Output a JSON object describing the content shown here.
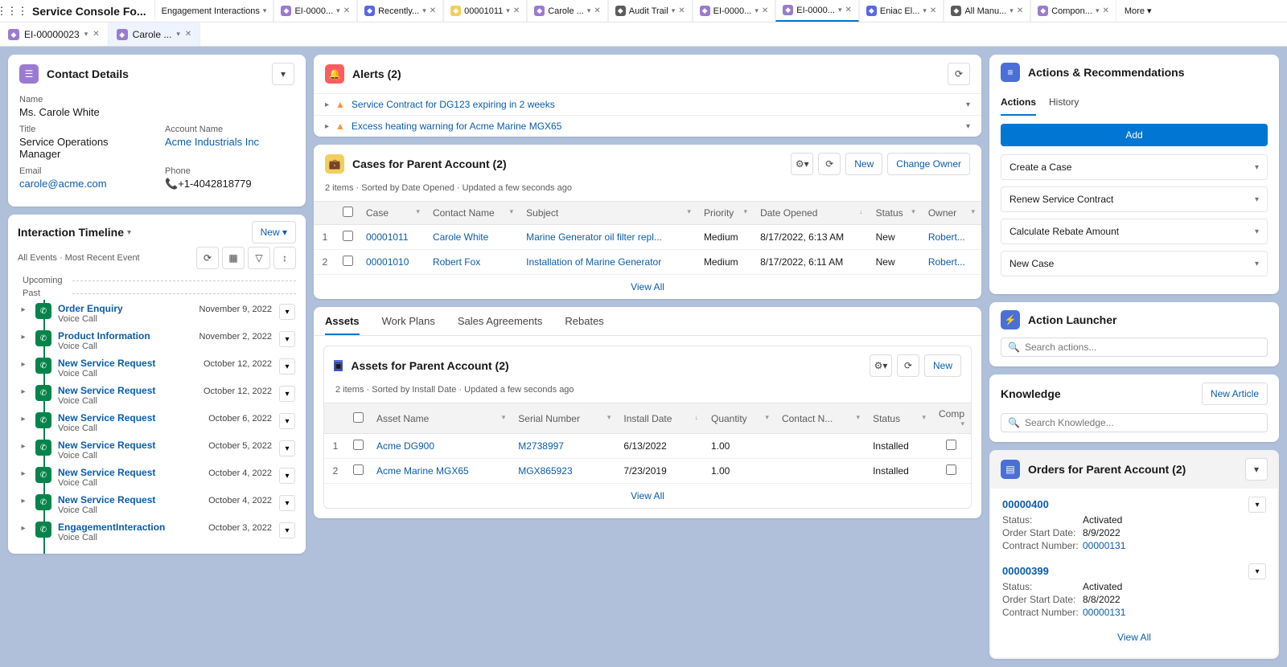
{
  "appName": "Service Console Fo...",
  "moreLabel": "More",
  "navTabs": [
    {
      "label": "Engagement Interactions",
      "closeable": false,
      "iconBg": ""
    },
    {
      "label": "EI-0000...",
      "closeable": true,
      "iconBg": "#9a7bcf"
    },
    {
      "label": "Recently...",
      "closeable": true,
      "iconBg": "#5867e8"
    },
    {
      "label": "00001011",
      "closeable": true,
      "iconBg": "#f2cf5b"
    },
    {
      "label": "Carole ...",
      "closeable": true,
      "iconBg": "#9a7bcf"
    },
    {
      "label": "Audit Trail",
      "closeable": true,
      "iconBg": "#5c5c5c"
    },
    {
      "label": "EI-0000...",
      "closeable": true,
      "iconBg": "#9a7bcf"
    },
    {
      "label": "EI-0000...",
      "closeable": true,
      "iconBg": "#9a7bcf",
      "active": true
    },
    {
      "label": "Eniac El...",
      "closeable": true,
      "iconBg": "#5867e8"
    },
    {
      "label": "All Manu...",
      "closeable": true,
      "iconBg": "#5c5c5c"
    },
    {
      "label": "Compon...",
      "closeable": true,
      "iconBg": "#9a7bcf"
    }
  ],
  "subTabs": [
    {
      "label": "EI-00000023",
      "active": false
    },
    {
      "label": "Carole ...",
      "active": true
    }
  ],
  "contactDetails": {
    "title": "Contact Details",
    "fields": {
      "nameLabel": "Name",
      "nameValue": "Ms. Carole White",
      "titleLabel": "Title",
      "titleValue": "Service Operations Manager",
      "accountLabel": "Account Name",
      "accountValue": "Acme Industrials Inc",
      "emailLabel": "Email",
      "emailValue": "carole@acme.com",
      "phoneLabel": "Phone",
      "phoneValue": "+1-4042818779"
    }
  },
  "timeline": {
    "title": "Interaction Timeline",
    "newLabel": "New",
    "subtitle": "All Events · Most Recent Event",
    "upcoming": "Upcoming",
    "past": "Past",
    "items": [
      {
        "title": "Order Enquiry",
        "sub": "Voice Call",
        "date": "November 9, 2022"
      },
      {
        "title": "Product Information",
        "sub": "Voice Call",
        "date": "November 2, 2022"
      },
      {
        "title": "New Service Request",
        "sub": "Voice Call",
        "date": "October 12, 2022"
      },
      {
        "title": "New Service Request",
        "sub": "Voice Call",
        "date": "October 12, 2022"
      },
      {
        "title": "New Service Request",
        "sub": "Voice Call",
        "date": "October 6, 2022"
      },
      {
        "title": "New Service Request",
        "sub": "Voice Call",
        "date": "October 5, 2022"
      },
      {
        "title": "New Service Request",
        "sub": "Voice Call",
        "date": "October 4, 2022"
      },
      {
        "title": "New Service Request",
        "sub": "Voice Call",
        "date": "October 4, 2022"
      },
      {
        "title": "EngagementInteraction",
        "sub": "Voice Call",
        "date": "October 3, 2022"
      }
    ]
  },
  "alerts": {
    "title": "Alerts (2)",
    "items": [
      {
        "text": "Service Contract for DG123 expiring in 2 weeks"
      },
      {
        "text": "Excess heating warning for Acme Marine MGX65"
      }
    ]
  },
  "cases": {
    "title": "Cases for Parent Account (2)",
    "meta": "2 items · Sorted by Date Opened · Updated a few seconds ago",
    "newLabel": "New",
    "changeOwner": "Change Owner",
    "cols": [
      "Case",
      "Contact Name",
      "Subject",
      "Priority",
      "Date Opened",
      "Status",
      "Owner"
    ],
    "rows": [
      {
        "num": "1",
        "case": "00001011",
        "contact": "Carole White",
        "subject": "Marine Generator oil filter repl...",
        "priority": "Medium",
        "opened": "8/17/2022, 6:13 AM",
        "status": "New",
        "owner": "Robert..."
      },
      {
        "num": "2",
        "case": "00001010",
        "contact": "Robert Fox",
        "subject": "Installation of Marine Generator",
        "priority": "Medium",
        "opened": "8/17/2022, 6:11 AM",
        "status": "New",
        "owner": "Robert..."
      }
    ],
    "viewAll": "View All"
  },
  "midTabs": [
    "Assets",
    "Work Plans",
    "Sales Agreements",
    "Rebates"
  ],
  "assets": {
    "title": "Assets for Parent Account (2)",
    "meta": "2 items · Sorted by Install Date · Updated a few seconds ago",
    "newLabel": "New",
    "cols": [
      "Asset Name",
      "Serial Number",
      "Install Date",
      "Quantity",
      "Contact N...",
      "Status",
      "Comp"
    ],
    "rows": [
      {
        "num": "1",
        "name": "Acme DG900",
        "serial": "M2738997",
        "install": "6/13/2022",
        "qty": "1.00",
        "contact": "",
        "status": "Installed"
      },
      {
        "num": "2",
        "name": "Acme Marine MGX65",
        "serial": "MGX865923",
        "install": "7/23/2019",
        "qty": "1.00",
        "contact": "",
        "status": "Installed"
      }
    ],
    "viewAll": "View All"
  },
  "actionsRecs": {
    "title": "Actions & Recommendations",
    "tabs": [
      "Actions",
      "History"
    ],
    "addLabel": "Add",
    "items": [
      "Create a Case",
      "Renew Service Contract",
      "Calculate Rebate Amount",
      "New Case"
    ]
  },
  "actionLauncher": {
    "title": "Action Launcher",
    "placeholder": "Search actions..."
  },
  "knowledge": {
    "title": "Knowledge",
    "newArticle": "New Article",
    "placeholder": "Search Knowledge..."
  },
  "orders": {
    "title": "Orders for Parent Account (2)",
    "viewAll": "View All",
    "items": [
      {
        "num": "00000400",
        "statusLabel": "Status:",
        "status": "Activated",
        "startLabel": "Order Start Date:",
        "start": "8/9/2022",
        "contractLabel": "Contract Number:",
        "contract": "00000131"
      },
      {
        "num": "00000399",
        "statusLabel": "Status:",
        "status": "Activated",
        "startLabel": "Order Start Date:",
        "start": "8/8/2022",
        "contractLabel": "Contract Number:",
        "contract": "00000131"
      }
    ]
  }
}
